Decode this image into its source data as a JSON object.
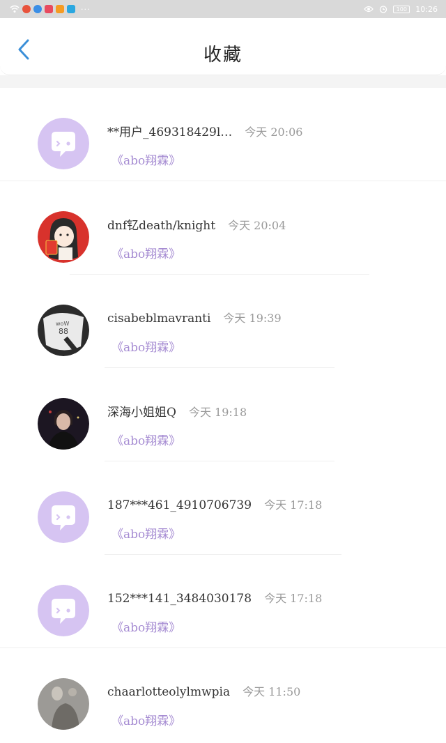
{
  "status_bar": {
    "time": "10:26",
    "battery": "100",
    "colors": {
      "weibo": "#e8533c",
      "browser": "#3a8ee6",
      "mail": "#e84a5f",
      "video": "#f59b23",
      "search": "#2aa7e0"
    }
  },
  "header": {
    "title": "收藏",
    "back_icon": "chevron-left-icon",
    "accent_color": "#3b8fd8"
  },
  "favorites": [
    {
      "username": "**用户_469318429l…",
      "time": "今天 20:06",
      "book": "《abo翔霖》",
      "avatar": "default-chat"
    },
    {
      "username": "dnf钇death/knight",
      "time": "今天 20:04",
      "book": "《abo翔霖》",
      "avatar": "red-envelope-girl"
    },
    {
      "username": "cisabeblmavranti",
      "time": "今天 19:39",
      "book": "《abo翔霖》",
      "avatar": "bw-photo"
    },
    {
      "username": "深海小姐姐Q",
      "time": "今天 19:18",
      "book": "《abo翔霖》",
      "avatar": "dark-portrait"
    },
    {
      "username": "187***461_4910706739",
      "time": "今天 17:18",
      "book": "《abo翔霖》",
      "avatar": "default-chat"
    },
    {
      "username": "152***141_3484030178",
      "time": "今天 17:18",
      "book": "《abo翔霖》",
      "avatar": "default-chat"
    },
    {
      "username": "chaarlotteolylmwpia",
      "time": "今天 11:50",
      "book": "《abo翔霖》",
      "avatar": "grey-photo"
    }
  ],
  "colors": {
    "default_avatar": "#d6c4f2",
    "book_link": "#a58bd2"
  }
}
